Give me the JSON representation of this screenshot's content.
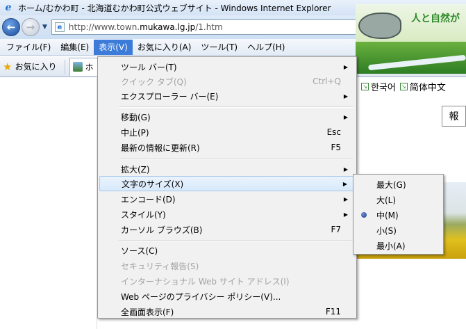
{
  "window": {
    "title": "ホーム/むかわ町 - 北海道むかわ町公式ウェブサイト - Windows Internet Explorer"
  },
  "address_bar": {
    "url_prefix": "http://www.town.",
    "url_domain": "mukawa.lg.jp",
    "url_suffix": "/1.htm"
  },
  "menubar": {
    "items": [
      {
        "label": "ファイル(F)"
      },
      {
        "label": "編集(E)"
      },
      {
        "label": "表示(V)",
        "active": true
      },
      {
        "label": "お気に入り(A)"
      },
      {
        "label": "ツール(T)"
      },
      {
        "label": "ヘルプ(H)"
      }
    ]
  },
  "favorites_bar": {
    "label": "お気に入り",
    "tab_label": "ホ"
  },
  "page": {
    "slogan": "人と自然が",
    "lang_links": [
      "한국어",
      "简体中文"
    ],
    "tag_fragment": "報"
  },
  "view_menu": {
    "items": [
      {
        "label": "ツール バー(T)",
        "shortcut": "",
        "submenu": true,
        "disabled": false
      },
      {
        "label": "クイック タブ(Q)",
        "shortcut": "Ctrl+Q",
        "submenu": false,
        "disabled": true
      },
      {
        "label": "エクスプローラー バー(E)",
        "shortcut": "",
        "submenu": true,
        "disabled": false
      },
      {
        "label": "移動(G)",
        "shortcut": "",
        "submenu": true,
        "disabled": false
      },
      {
        "label": "中止(P)",
        "shortcut": "Esc",
        "submenu": false,
        "disabled": false
      },
      {
        "label": "最新の情報に更新(R)",
        "shortcut": "F5",
        "submenu": false,
        "disabled": false
      },
      {
        "label": "拡大(Z)",
        "shortcut": "",
        "submenu": true,
        "disabled": false
      },
      {
        "label": "文字のサイズ(X)",
        "shortcut": "",
        "submenu": true,
        "disabled": false,
        "highlighted": true
      },
      {
        "label": "エンコード(D)",
        "shortcut": "",
        "submenu": true,
        "disabled": false
      },
      {
        "label": "スタイル(Y)",
        "shortcut": "",
        "submenu": true,
        "disabled": false
      },
      {
        "label": "カーソル ブラウズ(B)",
        "shortcut": "F7",
        "submenu": false,
        "disabled": false
      },
      {
        "label": "ソース(C)",
        "shortcut": "",
        "submenu": false,
        "disabled": false
      },
      {
        "label": "セキュリティ報告(S)",
        "shortcut": "",
        "submenu": false,
        "disabled": true
      },
      {
        "label": "インターナショナル Web サイト アドレス(I)",
        "shortcut": "",
        "submenu": false,
        "disabled": true
      },
      {
        "label": "Web ページのプライバシー ポリシー(V)...",
        "shortcut": "",
        "submenu": false,
        "disabled": false
      },
      {
        "label": "全画面表示(F)",
        "shortcut": "F11",
        "submenu": false,
        "disabled": false
      }
    ]
  },
  "text_size_menu": {
    "items": [
      {
        "label": "最大(G)",
        "selected": false
      },
      {
        "label": "大(L)",
        "selected": false
      },
      {
        "label": "中(M)",
        "selected": true
      },
      {
        "label": "小(S)",
        "selected": false
      },
      {
        "label": "最小(A)",
        "selected": false
      }
    ]
  },
  "colors": {
    "menu_active": "#3d7bd8",
    "menu_bg": "#f1f1f1",
    "disabled_text": "#a3a3a3"
  }
}
